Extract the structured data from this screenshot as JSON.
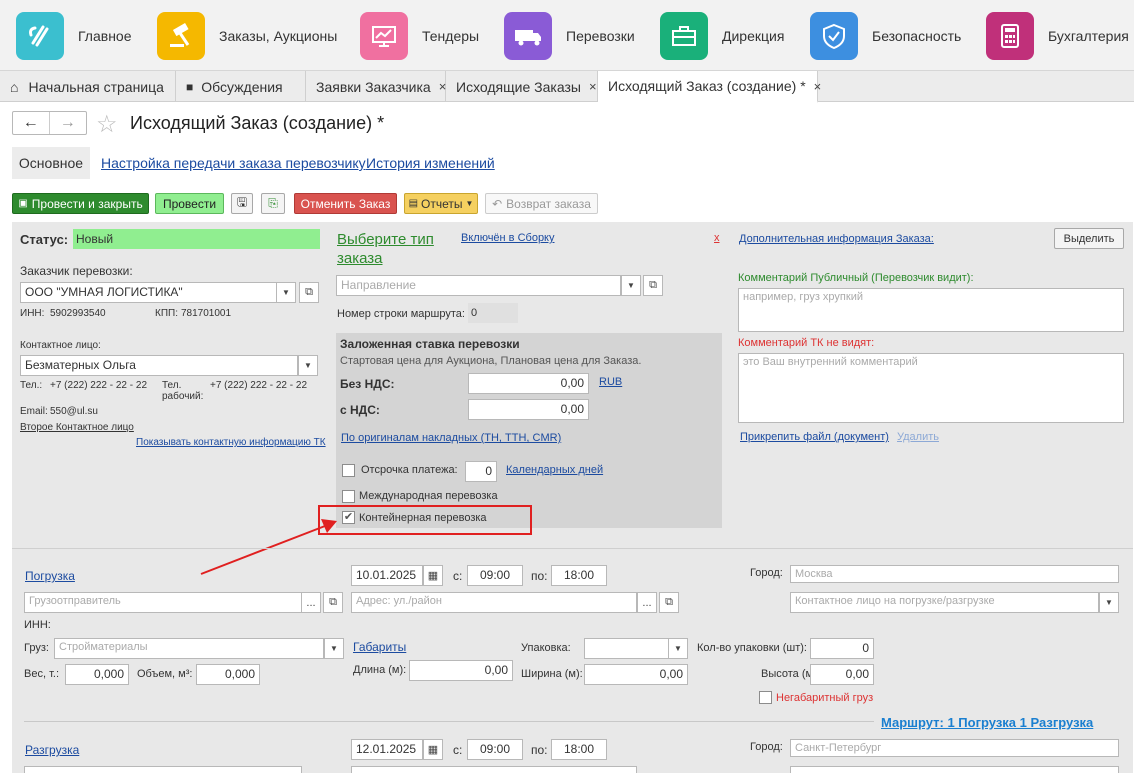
{
  "nav": [
    {
      "label": "Главное",
      "icon": "logo-icon",
      "color": "#3bbfcf"
    },
    {
      "label": "Заказы, Аукционы",
      "icon": "auction-hammer-icon",
      "color": "#f5b800"
    },
    {
      "label": "Тендеры",
      "icon": "chart-monitor-icon",
      "color": "#f070a0"
    },
    {
      "label": "Перевозки",
      "icon": "truck-icon",
      "color": "#8a5bd6"
    },
    {
      "label": "Дирекция",
      "icon": "briefcase-icon",
      "color": "#1ab07a"
    },
    {
      "label": "Безопасность",
      "icon": "shield-icon",
      "color": "#3d8fe0"
    },
    {
      "label": "Бухгалтерия",
      "icon": "calculator-icon",
      "color": "#c0307a"
    }
  ],
  "tabs": [
    {
      "label": "Начальная страница",
      "icon": "home-icon"
    },
    {
      "label": "Обсуждения",
      "icon": "chat-icon"
    },
    {
      "label": "Заявки Заказчика",
      "close": "×"
    },
    {
      "label": "Исходящие Заказы",
      "close": "×"
    },
    {
      "label": "Исходящий Заказ (создание) *",
      "close": "×"
    }
  ],
  "page": {
    "title": "Исходящий Заказ (создание) *",
    "subtabs": [
      "Основное",
      "Настройка передачи заказа перевозчику",
      "История изменений"
    ]
  },
  "toolbar": {
    "post_close": "Провести и закрыть",
    "post": "Провести",
    "cancel_order": "Отменить Заказ",
    "reports": "Отчеты",
    "return_order": "Возврат заказа"
  },
  "left": {
    "status_label": "Статус:",
    "status_value": "Новый",
    "customer_label": "Заказчик перевозки:",
    "customer_value": "ООО \"УМНАЯ ЛОГИСТИКА\"",
    "inn_label": "ИНН:",
    "inn_value": "5902993540",
    "kpp_label": "КПП:",
    "kpp_value": "781701001",
    "contact_label": "Контактное лицо:",
    "contact_value": "Безматерных Ольга",
    "tel_label": "Тел.:",
    "tel_value": "+7 (222) 222 - 22 - 22",
    "tel_work_label": "Тел. рабочий:",
    "tel_work_value": "+7 (222) 222 - 22 - 22",
    "email_label": "Email:",
    "email_value": "550@ul.su",
    "second_contact": "Второе Контактное лицо",
    "show_contact_tk": "Показывать контактную информацию ТК"
  },
  "middle": {
    "order_type": "Выберите тип заказа",
    "included": "Включён в Сборку",
    "x": "x",
    "direction_placeholder": "Направление",
    "route_row_label": "Номер строки маршрута:",
    "route_row_value": "0",
    "rate_title": "Заложенная ставка перевозки",
    "rate_sub": "Стартовая цена для Аукциона, Плановая цена для Заказа.",
    "no_vat_label": "Без НДС:",
    "no_vat_value": "0,00",
    "currency": "RUB",
    "vat_label": "с НДС:",
    "vat_value": "0,00",
    "originals": "По оригиналам накладных (ТН, ТТН, CMR)",
    "deferral_label": "Отсрочка платежа:",
    "deferral_value": "0",
    "calendar_days": "Календарных дней",
    "international": "Международная перевозка",
    "container": "Контейнерная перевозка"
  },
  "right": {
    "additional_info": "Дополнительная информация Заказа:",
    "highlight_btn": "Выделить",
    "public_comment_label": "Комментарий Публичный (Перевозчик видит):",
    "public_comment_placeholder": "например, груз хрупкий",
    "private_comment_label": "Комментарий ТК не видят:",
    "private_comment_placeholder": "это Ваш внутренний комментарий",
    "attach_file": "Прикрепить файл (документ)",
    "delete": "Удалить"
  },
  "loading": {
    "title": "Погрузка",
    "date": "10.01.2025",
    "from_label": "с:",
    "from": "09:00",
    "to_label": "по:",
    "to": "18:00",
    "city_label": "Город:",
    "city_placeholder": "Москва",
    "shipper_placeholder": "Грузоотправитель",
    "address_placeholder": "Адрес: ул./район",
    "contact_placeholder": "Контактное лицо на погрузке/разгрузке",
    "inn_label": "ИНН:",
    "cargo_label": "Груз:",
    "cargo_placeholder": "Стройматериалы",
    "dimensions": "Габариты",
    "packing_label": "Упаковка:",
    "pack_count_label": "Кол-во упаковки (шт):",
    "pack_count_value": "0",
    "weight_label": "Вес, т.:",
    "weight_value": "0,000",
    "volume_label": "Объем, м³:",
    "volume_value": "0,000",
    "length_label": "Длина (м):",
    "length_value": "0,00",
    "width_label": "Ширина (м):",
    "width_value": "0,00",
    "height_label": "Высота (м):",
    "height_value": "0,00",
    "oversize": "Негабаритный груз",
    "route": "Маршрут:  1 Погрузка  1 Разгрузка"
  },
  "unloading": {
    "title": "Разгрузка",
    "date": "12.01.2025",
    "from_label": "с:",
    "from": "09:00",
    "to_label": "по:",
    "to": "18:00",
    "city_label": "Город:",
    "city_placeholder": "Санкт-Петербург"
  },
  "colors": {
    "green_btn": "#2e8b2e",
    "status_bg": "#90ee90",
    "red": "#d9534f",
    "accent": "#e02020"
  }
}
